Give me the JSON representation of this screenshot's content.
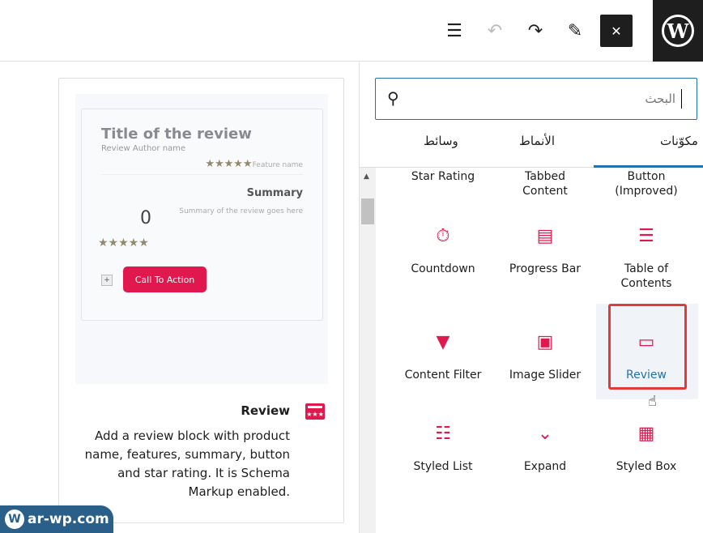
{
  "topbar": {
    "list_view": "☰",
    "undo": "↶",
    "redo": "↷",
    "tools": "✎",
    "close": "✕",
    "wp_logo": "W"
  },
  "preview": {
    "title": "Title of the review",
    "author": "Review Author name",
    "feature": "Feature name",
    "stars": "★★★★★",
    "summary": "Summary",
    "summary_desc": "Summary of the review goes here",
    "score": "0",
    "plus": "+",
    "cta": "Call To Action"
  },
  "info": {
    "title": "Review",
    "description": "Add a review block with product name, features, summary, button and star rating. It is Schema Markup enabled."
  },
  "watermark": "ar-wp.com",
  "search": {
    "placeholder": "البحث"
  },
  "tabs": [
    {
      "label": "مكوّنات"
    },
    {
      "label": "الأنماط"
    },
    {
      "label": "وسائط"
    }
  ],
  "blocks": {
    "partial": [
      "Star Rating",
      "Tabbed Content",
      "Button (Improved)"
    ],
    "rows": [
      [
        {
          "label": "Countdown",
          "icon": "⏱"
        },
        {
          "label": "Progress Bar",
          "icon": "▤"
        },
        {
          "label": "Table of Contents",
          "icon": "☰"
        }
      ],
      [
        {
          "label": "Content Filter",
          "icon": "▼"
        },
        {
          "label": "Image Slider",
          "icon": "▣"
        },
        {
          "label": "Review",
          "icon": "▭"
        }
      ],
      [
        {
          "label": "Styled List",
          "icon": "☷"
        },
        {
          "label": "Expand",
          "icon": "⌄"
        },
        {
          "label": "Styled Box",
          "icon": "▦"
        }
      ]
    ]
  },
  "colors": {
    "accent": "#e1184d",
    "primary": "#2271b1",
    "highlight": "#e03a3a"
  }
}
